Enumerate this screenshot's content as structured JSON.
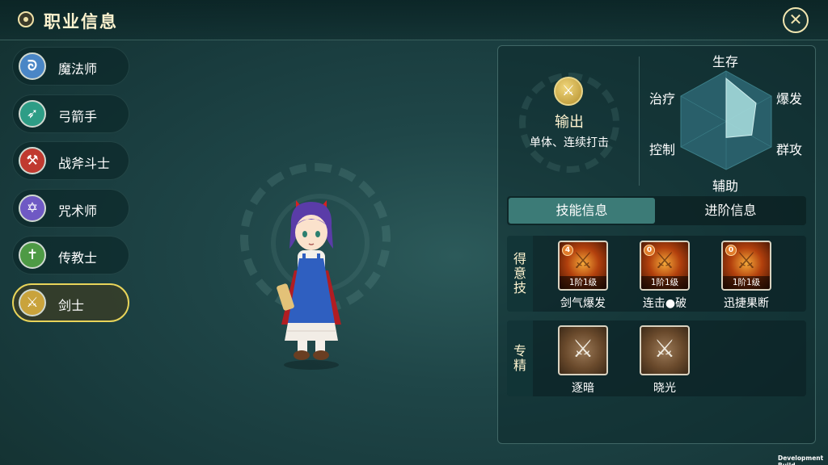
{
  "header": {
    "title": "职业信息",
    "title_icon": "emblem-icon",
    "close_icon": "close-icon",
    "close_glyph": "✕"
  },
  "classes": [
    {
      "label": "魔法师",
      "icon": "staff-icon",
      "glyph": "ᘐ",
      "color": "#4a86c6",
      "selected": false
    },
    {
      "label": "弓箭手",
      "icon": "bow-icon",
      "glyph": "➶",
      "color": "#2e9d86",
      "selected": false
    },
    {
      "label": "战斧斗士",
      "icon": "axe-icon",
      "glyph": "⚒",
      "color": "#c03a30",
      "selected": false
    },
    {
      "label": "咒术师",
      "icon": "hexagram-icon",
      "glyph": "✡",
      "color": "#6f59c4",
      "selected": false
    },
    {
      "label": "传教士",
      "icon": "cross-icon",
      "glyph": "✝",
      "color": "#4e9a45",
      "selected": false
    },
    {
      "label": "剑士",
      "icon": "sword-icon",
      "glyph": "⚔",
      "color": "#c9a33c",
      "selected": true
    }
  ],
  "role": {
    "icon": "sword-icon",
    "glyph": "⚔",
    "name": "输出",
    "description": "单体、连续打击"
  },
  "stats": {
    "labels": {
      "survival": "生存",
      "burst": "爆发",
      "aoe": "群攻",
      "support": "辅助",
      "control": "控制",
      "healing": "治疗"
    },
    "values": {
      "survival": 0.85,
      "burst": 0.7,
      "aoe": 0.6,
      "support": 0.35,
      "control": 0.0,
      "healing": 0.0
    }
  },
  "tabs": {
    "skills": "技能信息",
    "advanced": "进阶信息",
    "active": "skills"
  },
  "signature_skills": {
    "section_label": [
      "得",
      "意",
      "技"
    ],
    "items": [
      {
        "name": "剑气爆发",
        "level": "1阶1级",
        "badge": "4"
      },
      {
        "name": "连击●破",
        "level": "1阶1级",
        "badge": "0"
      },
      {
        "name": "迅捷果断",
        "level": "1阶1级",
        "badge": "0"
      }
    ]
  },
  "mastery": {
    "section_label": [
      "专",
      "精"
    ],
    "items": [
      {
        "name": "逐暗",
        "icon": "moon-sword-icon",
        "glyph": "⚔"
      },
      {
        "name": "晓光",
        "icon": "sun-sword-icon",
        "glyph": "⚔"
      }
    ]
  },
  "footer": {
    "build_label": "Development Build"
  }
}
